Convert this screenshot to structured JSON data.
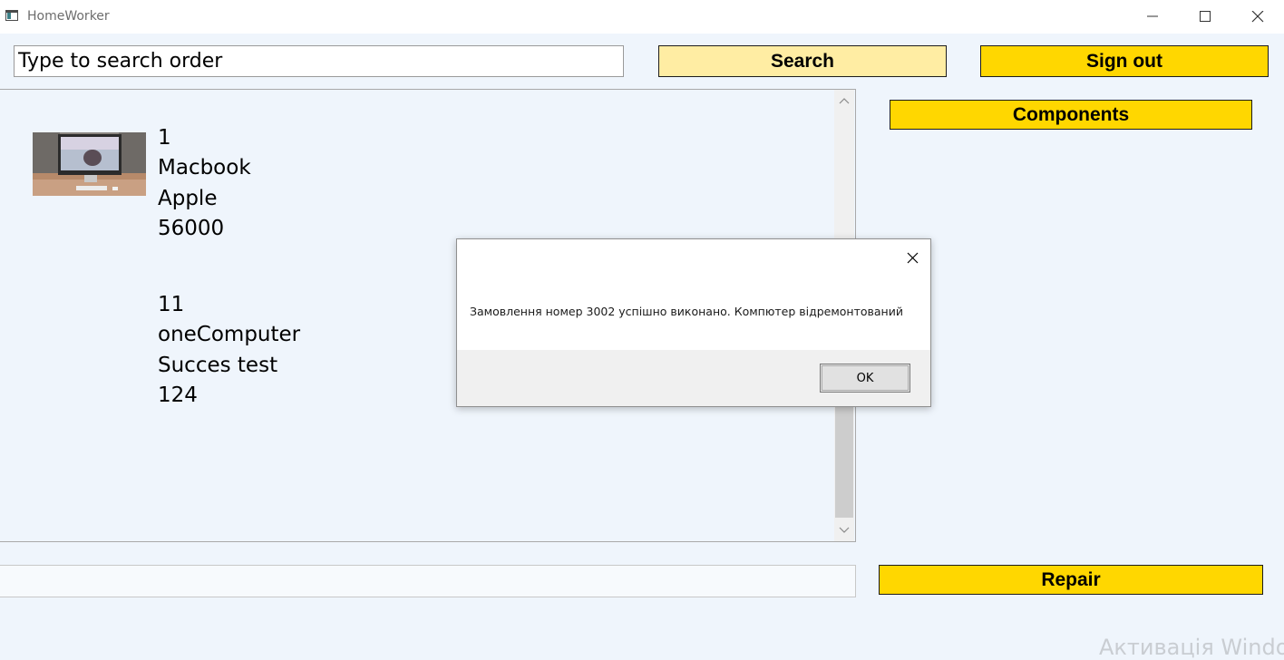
{
  "window": {
    "title": "HomeWorker"
  },
  "search": {
    "placeholder": "Type to search order",
    "button_label": "Search"
  },
  "header": {
    "sign_out_label": "Sign out"
  },
  "sidebar": {
    "components_label": "Components"
  },
  "orders": [
    {
      "id": "1",
      "name": "Macbook",
      "brand": "Apple",
      "price": "56000",
      "has_image": true
    },
    {
      "id": "11",
      "name": "oneComputer",
      "brand": "Succes test",
      "price": "124",
      "has_image": false
    }
  ],
  "footer": {
    "repair_label": "Repair",
    "input_value": ""
  },
  "dialog": {
    "message": "Замовлення номер 3002 успішно виконано. Компютер відремонтований",
    "ok_label": "OK"
  },
  "watermark": {
    "text": "Активація Windows"
  },
  "colors": {
    "accent_yellow": "#ffd700",
    "search_button": "#ffeda3",
    "background": "#eff5fc"
  },
  "icons": {
    "app": "app-window-icon",
    "minimize": "minimize-icon",
    "maximize": "maximize-icon",
    "close": "close-icon"
  }
}
